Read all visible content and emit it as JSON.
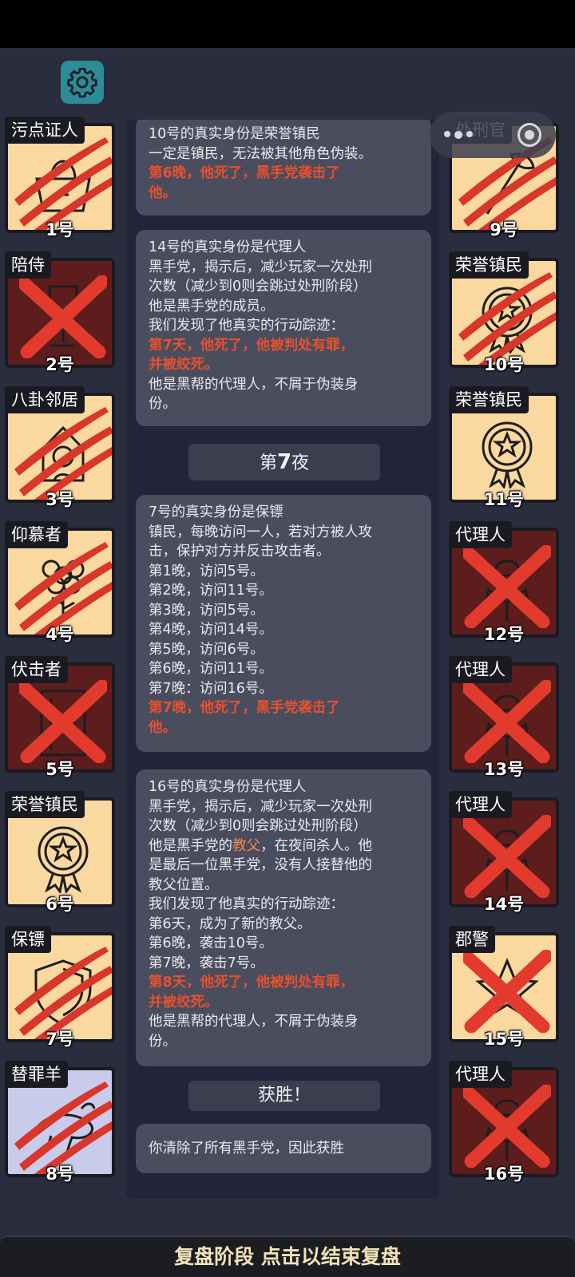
{
  "header": {
    "settings_icon": "gear-icon"
  },
  "capsule": {
    "more_icon": "more-dots-icon",
    "close_icon": "target-close-icon"
  },
  "players_left": [
    {
      "name": "污点证人",
      "num": "1号",
      "state": "scratched",
      "icon": "witness-icon"
    },
    {
      "name": "陪侍",
      "num": "2号",
      "state": "dead",
      "icon": "wine-glass-icon"
    },
    {
      "name": "八卦邻居",
      "num": "3号",
      "state": "scratched",
      "icon": "neighbor-icon"
    },
    {
      "name": "仰慕者",
      "num": "4号",
      "state": "scratched",
      "icon": "flower-icon"
    },
    {
      "name": "伏击者",
      "num": "5号",
      "state": "dead",
      "icon": "door-icon"
    },
    {
      "name": "荣誉镇民",
      "num": "6号",
      "state": "alive",
      "icon": "medal-icon"
    },
    {
      "name": "保镖",
      "num": "7号",
      "state": "scratched",
      "icon": "shield-icon"
    },
    {
      "name": "替罪羊",
      "num": "8号",
      "state": "scratched",
      "icon": "goat-icon"
    }
  ],
  "players_right": [
    {
      "name": "处刑官",
      "num": "9号",
      "state": "scratched",
      "icon": "axe-icon"
    },
    {
      "name": "荣誉镇民",
      "num": "10号",
      "state": "scratched",
      "icon": "medal-icon"
    },
    {
      "name": "荣誉镇民",
      "num": "11号",
      "state": "alive",
      "icon": "medal-icon"
    },
    {
      "name": "代理人",
      "num": "12号",
      "state": "dead",
      "icon": "hat-coat-icon"
    },
    {
      "name": "代理人",
      "num": "13号",
      "state": "dead",
      "icon": "hat-coat-icon"
    },
    {
      "name": "代理人",
      "num": "14号",
      "state": "dead",
      "icon": "hat-coat-icon"
    },
    {
      "name": "郡警",
      "num": "15号",
      "state": "dead-light",
      "icon": "sheriff-star-icon"
    },
    {
      "name": "代理人",
      "num": "16号",
      "state": "dead",
      "icon": "hat-coat-icon"
    }
  ],
  "log": {
    "msg1": {
      "l1": "10号的真实身份是荣誉镇民",
      "l2": "一定是镇民，无法被其他角色伪装。",
      "l3": "第6晚，他死了，黑手党袭击了",
      "l4": "他。"
    },
    "msg2": {
      "l1": "14号的真实身份是代理人",
      "l2": "黑手党，揭示后，减少玩家一次处刑",
      "l3": "次数（减少到0则会跳过处刑阶段）",
      "l4": "他是黑手党的成员。",
      "l5": "我们发现了他真实的行动踪迹：",
      "l6": "第7天，他死了，他被判处有罪，",
      "l7": "并被绞死。",
      "l8": "他是黑帮的代理人，不屑于伪装身",
      "l9": "份。"
    },
    "night_banner": {
      "prefix": "第",
      "num": "7",
      "suffix": "夜"
    },
    "msg3": {
      "l1": "7号的真实身份是保镖",
      "l2": "镇民，每晚访问一人，若对方被人攻",
      "l3": "击，保护对方并反击攻击者。",
      "l4": "第1晚，访问5号。",
      "l5": "第2晚，访问11号。",
      "l6": "第3晚，访问5号。",
      "l7": "第4晚，访问14号。",
      "l8": "第5晚，访问6号。",
      "l9": "第6晚，访问11号。",
      "l10": "第7晚：访问16号。",
      "l11": "第7晚，他死了，黑手党袭击了",
      "l12": "他。"
    },
    "msg4": {
      "l1": "16号的真实身份是代理人",
      "l2": "黑手党，揭示后，减少玩家一次处刑",
      "l3": "次数（减少到0则会跳过处刑阶段）",
      "l4a": "他是黑手党的",
      "l4b": "教父",
      "l4c": "，在夜间杀人。他",
      "l5": "是最后一位黑手党，没有人接替他的",
      "l6": "教父位置。",
      "l7": "我们发现了他真实的行动踪迹：",
      "l8": "第6天，成为了新的教父。",
      "l9": "第6晚，袭击10号。",
      "l10": "第7晚，袭击7号。",
      "l11": "第8天，他死了，他被判处有罪，",
      "l12": "并被绞死。",
      "l13": "他是黑帮的代理人，不屑于伪装身",
      "l14": "份。"
    },
    "victory_banner": "获胜！",
    "msg5": "你清除了所有黑手党，因此获胜"
  },
  "bottom_bar": {
    "label": "复盘阶段 点击以结束复盘"
  },
  "colors": {
    "card_alive": "#fad9a0",
    "card_dead": "#5d1d1d",
    "claw_red": "#d8372b",
    "highlight_red": "#e8502f",
    "settings_teal": "#2c8c97"
  }
}
